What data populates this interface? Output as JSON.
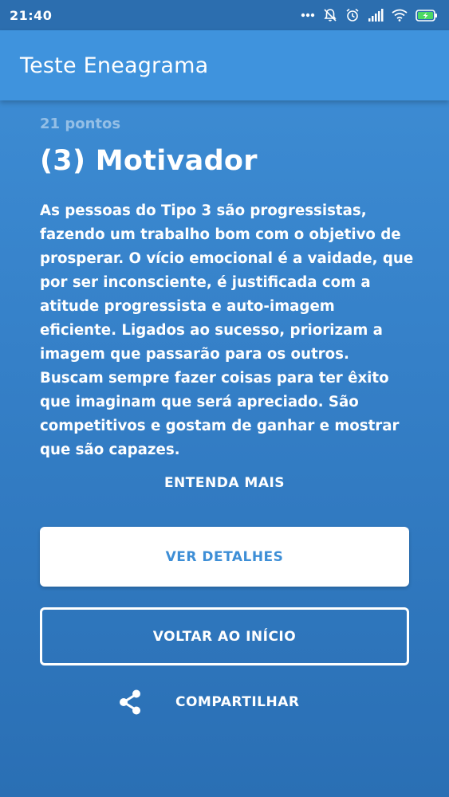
{
  "status_bar": {
    "time": "21:40",
    "icons": [
      "more-dots-icon",
      "bell-off-icon",
      "alarm-icon",
      "signal-icon",
      "wifi-icon",
      "battery-charging-icon"
    ]
  },
  "app_bar": {
    "title": "Teste Eneagrama"
  },
  "result": {
    "score": "21 pontos",
    "type_title": "(3) Motivador",
    "description": "As pessoas do Tipo 3 são progressistas, fazendo um trabalho bom com o objetivo de prosperar. O vício emocional é a vaidade, que por ser inconsciente, é justificada com a atitude progressista e auto-imagem eficiente. Ligados ao sucesso, priorizam a imagem que passarão para os outros. Buscam sempre fazer coisas para ter êxito que imaginam que será apreciado. São competitivos e gostam de ganhar e mostrar que são capazes."
  },
  "actions": {
    "learn_more": "ENTENDA MAIS",
    "details": "VER DETALHES",
    "back_home": "VOLTAR AO INÍCIO",
    "share": "COMPARTILHAR"
  },
  "colors": {
    "status_bar": "#2c6eaf",
    "app_bar": "#3f93dd",
    "background_top": "#3f8fd6",
    "background_bottom": "#2a6fb4",
    "accent_text": "#3d8ed6"
  }
}
